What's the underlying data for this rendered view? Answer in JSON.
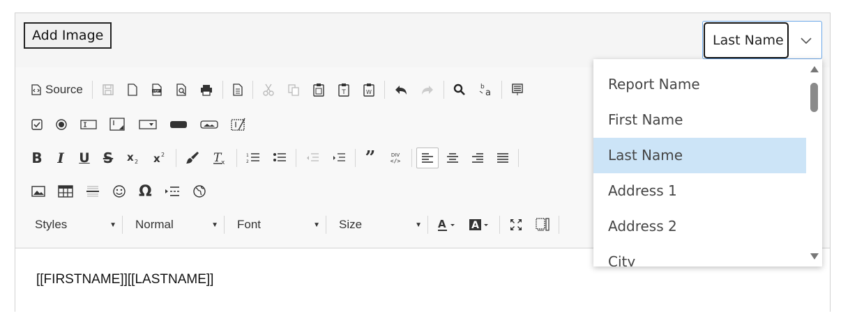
{
  "top_bar": {
    "add_image_label": "Add Image",
    "select": {
      "value": "Last Name"
    }
  },
  "toolbar": {
    "source_label": "Source",
    "styles_label": "Styles",
    "format_label": "Normal",
    "font_label": "Font",
    "size_label": "Size"
  },
  "dropdown": {
    "items": [
      {
        "label": "Report Name",
        "selected": false
      },
      {
        "label": "First Name",
        "selected": false
      },
      {
        "label": "Last Name",
        "selected": true
      },
      {
        "label": "Address 1",
        "selected": false
      },
      {
        "label": "Address 2",
        "selected": false
      },
      {
        "label": "City",
        "selected": false
      }
    ]
  },
  "editor": {
    "content": "[[FIRSTNAME]][[LASTNAME]]"
  },
  "colors": {
    "selected_highlight": "#cce4f7",
    "focus_border": "#6aa7e8"
  }
}
